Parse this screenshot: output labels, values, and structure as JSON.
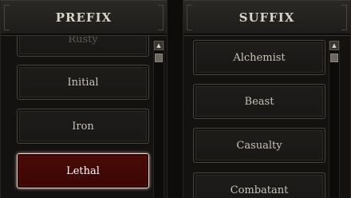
{
  "prefix": {
    "title": "PREFIX",
    "items": [
      {
        "label": "Rusty"
      },
      {
        "label": "Initial"
      },
      {
        "label": "Iron"
      },
      {
        "label": "Lethal"
      }
    ],
    "selected_label": "Lethal"
  },
  "suffix": {
    "title": "SUFFIX",
    "items": [
      {
        "label": "Alchemist"
      },
      {
        "label": "Beast"
      },
      {
        "label": "Casualty"
      },
      {
        "label": "Combatant"
      }
    ]
  },
  "icons": {
    "scroll_up": "arrow-up-icon"
  },
  "colors": {
    "selected_bg": "#4a0b07",
    "selected_border": "#f0d6c8",
    "item_text": "#c9c3b8",
    "header_text": "#d9d3c7"
  }
}
